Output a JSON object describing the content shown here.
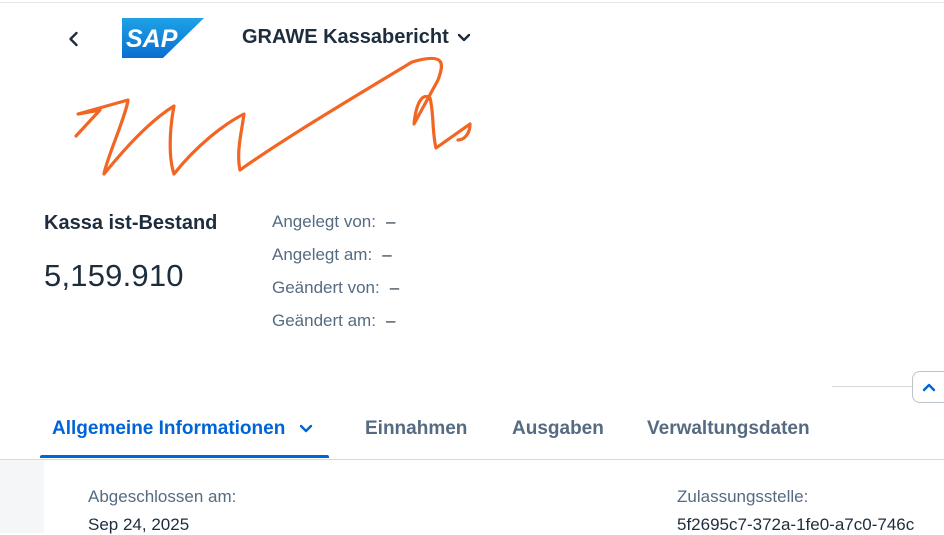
{
  "header": {
    "app_title": "GRAWE Kassabericht",
    "logo_text": "SAP",
    "back_icon": "chevron-left-icon",
    "title_dropdown_icon": "chevron-down-icon"
  },
  "key_figure": {
    "label": "Kassa ist-Bestand",
    "value": "5,159.910"
  },
  "admin_info": [
    {
      "label": "Angelegt von:",
      "value": "–"
    },
    {
      "label": "Angelegt am:",
      "value": "–"
    },
    {
      "label": "Geändert von:",
      "value": "–"
    },
    {
      "label": "Geändert am:",
      "value": "–"
    }
  ],
  "tabs": [
    {
      "label": "Allgemeine Informationen",
      "active": true
    },
    {
      "label": "Einnahmen",
      "active": false
    },
    {
      "label": "Ausgaben",
      "active": false
    },
    {
      "label": "Verwaltungsdaten",
      "active": false
    }
  ],
  "fields": [
    {
      "label": "Abgeschlossen am:",
      "value": "Sep 24, 2025"
    },
    {
      "label": "Zulassungsstelle:",
      "value": "5f2695c7-372a-1fe0-a7c0-746c"
    }
  ],
  "colors": {
    "brand_blue": "#0064d9",
    "text_dark": "#1d2d3e",
    "text_muted": "#556b82",
    "scribble": "#f26522",
    "sap_logo": "#0a6ed1"
  }
}
